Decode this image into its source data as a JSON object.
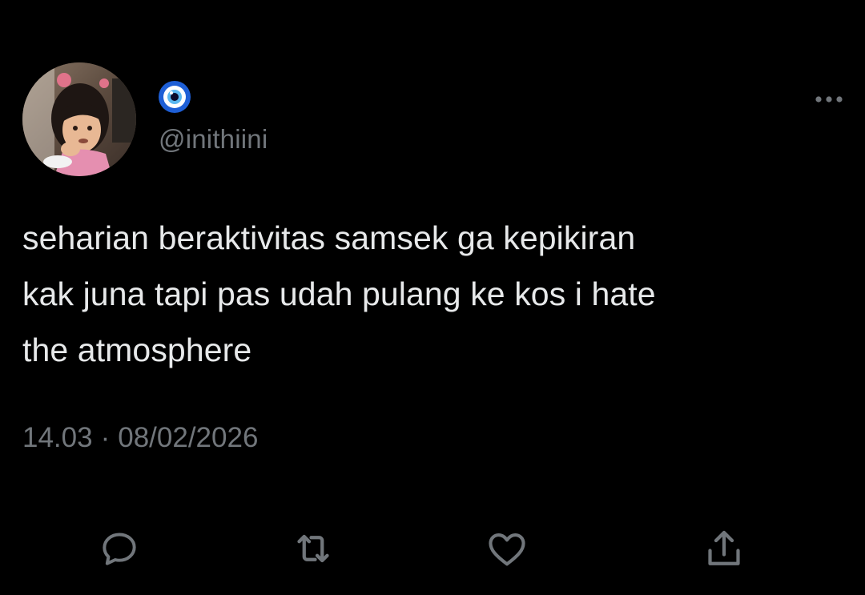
{
  "user": {
    "display_name_icon": "nazar-eye-emoji",
    "handle": "@inithiini",
    "avatar": "avatar-photo"
  },
  "tweet": {
    "text": "seharian beraktivitas samsek ga kepikiran\nkak juna tapi pas udah pulang ke kos i hate\nthe atmosphere",
    "time": "14.03",
    "separator": "·",
    "date": "08/02/2026"
  },
  "actions": {
    "reply_icon": "reply-icon",
    "retweet_icon": "retweet-icon",
    "like_icon": "heart-icon",
    "share_icon": "share-icon",
    "more_icon": "more-icon"
  },
  "colors": {
    "background": "#000000",
    "text": "#e7e9ea",
    "secondary": "#71767b"
  }
}
